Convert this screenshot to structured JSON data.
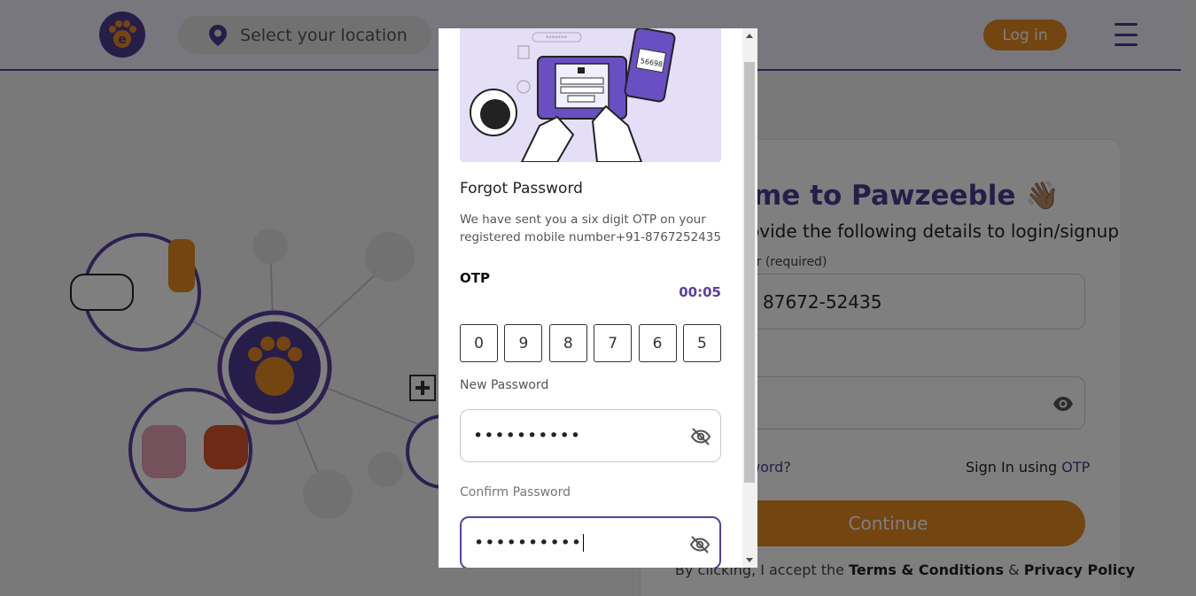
{
  "header": {
    "location_placeholder": "Select your location",
    "login_label": "Log in",
    "icons": [
      "paw-logo-icon",
      "location-pin-icon",
      "hamburger-menu-icon"
    ]
  },
  "login_card": {
    "welcome_title": "me to Pawzeeble",
    "welcome_emoji": "👋🏽",
    "subtitle": "ovide the following details to login/signup",
    "phone_label": "er (required)",
    "phone_value": "87672-52435",
    "forgot_link": "word?",
    "signin_prefix": "Sign In using ",
    "signin_otp": "OTP",
    "continue_label": "Continue",
    "terms_prefix": "By clicking, I accept the ",
    "terms_link": "Terms & Conditions",
    "terms_amp": " & ",
    "privacy_link": "Privacy Policy"
  },
  "modal": {
    "title": "Forgot Password",
    "description": "We have sent you a six digit OTP on your registered mobile number+91-8767252435",
    "otp_label": "OTP",
    "timer": "00:05",
    "otp_digits": [
      "0",
      "9",
      "8",
      "7",
      "6",
      "5"
    ],
    "new_password_label": "New Password",
    "new_password_value": "••••••••••",
    "confirm_password_label": "Confirm Password",
    "confirm_password_value": "••••••••••",
    "hero_phone_code": "56698"
  },
  "colors": {
    "brand_purple": "#4f3a93",
    "accent_orange": "#e58a23",
    "hero_lavender": "#e4def6"
  }
}
